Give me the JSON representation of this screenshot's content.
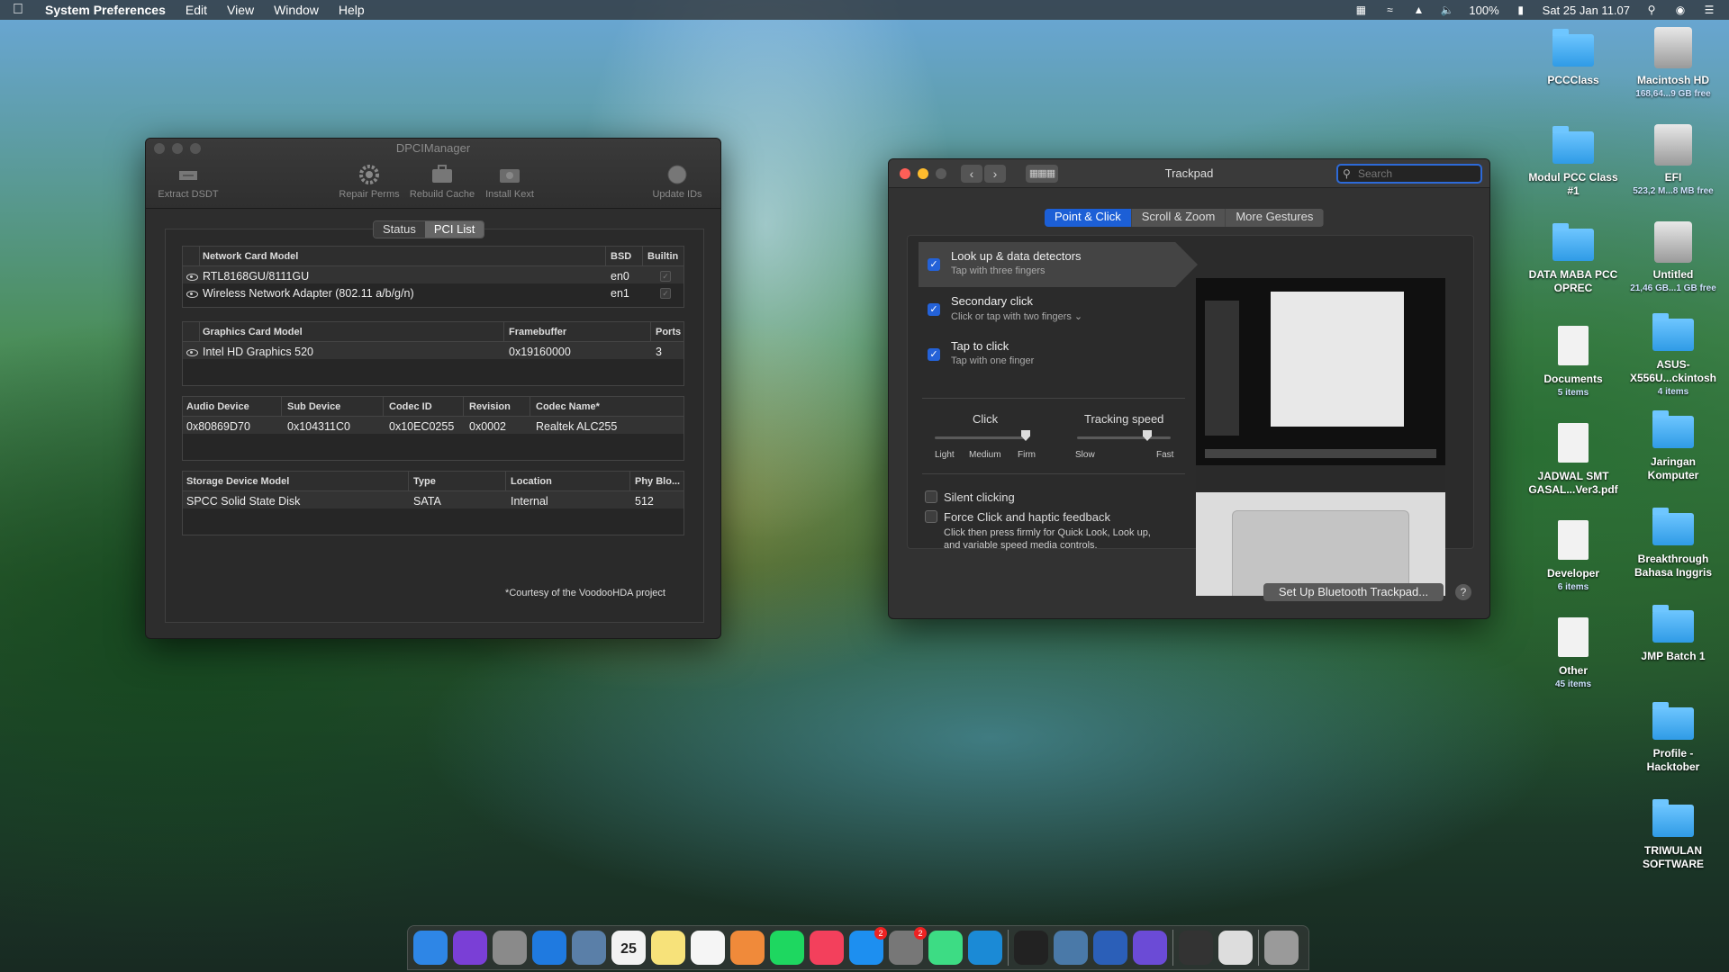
{
  "menubar": {
    "app_name": "System Preferences",
    "menus": [
      "Edit",
      "View",
      "Window",
      "Help"
    ],
    "battery": "100%",
    "datetime": "Sat 25 Jan  11.07"
  },
  "dpci": {
    "title": "DPCIManager",
    "toolbar": {
      "extract": "Extract DSDT",
      "repair": "Repair Perms",
      "rebuild": "Rebuild Cache",
      "install": "Install Kext",
      "update": "Update IDs"
    },
    "segments": {
      "status": "Status",
      "pci_list": "PCI List"
    },
    "network": {
      "headers": {
        "model": "Network Card Model",
        "bsd": "BSD",
        "builtin": "Builtin"
      },
      "rows": [
        {
          "model": "RTL8168GU/8111GU",
          "bsd": "en0"
        },
        {
          "model": "Wireless Network Adapter (802.11 a/b/g/n)",
          "bsd": "en1"
        }
      ]
    },
    "graphics": {
      "headers": {
        "model": "Graphics Card Model",
        "framebuffer": "Framebuffer",
        "ports": "Ports"
      },
      "rows": [
        {
          "model": "Intel HD Graphics 520",
          "framebuffer": "0x19160000",
          "ports": "3"
        }
      ]
    },
    "audio": {
      "headers": {
        "device": "Audio Device",
        "sub": "Sub Device",
        "codec": "Codec ID",
        "revision": "Revision",
        "name": "Codec Name*"
      },
      "rows": [
        {
          "device": "0x80869D70",
          "sub": "0x104311C0",
          "codec": "0x10EC0255",
          "revision": "0x0002",
          "name": "Realtek ALC255"
        }
      ]
    },
    "storage": {
      "headers": {
        "model": "Storage Device Model",
        "type": "Type",
        "location": "Location",
        "phy": "Phy Blo..."
      },
      "rows": [
        {
          "model": "SPCC Solid State Disk",
          "type": "SATA",
          "location": "Internal",
          "phy": "512"
        }
      ]
    },
    "courtesy": "*Courtesy of the VoodooHDA project"
  },
  "trackpad": {
    "title": "Trackpad",
    "search_placeholder": "Search",
    "tabs": {
      "point": "Point & Click",
      "scroll": "Scroll & Zoom",
      "more": "More Gestures"
    },
    "options": {
      "lookup": {
        "title": "Look up & data detectors",
        "sub": "Tap with three fingers"
      },
      "secondary": {
        "title": "Secondary click",
        "sub": "Click or tap with two fingers ⌄"
      },
      "tap": {
        "title": "Tap to click",
        "sub": "Tap with one finger"
      }
    },
    "click": {
      "label": "Click",
      "light": "Light",
      "medium": "Medium",
      "firm": "Firm",
      "value": "Firm"
    },
    "tracking": {
      "label": "Tracking speed",
      "slow": "Slow",
      "fast": "Fast",
      "value": 0.75
    },
    "silent": "Silent clicking",
    "force": {
      "title": "Force Click and haptic feedback",
      "desc1": "Click then press firmly for Quick Look, Look up,",
      "desc2": "and variable speed media controls."
    },
    "bt_button": "Set Up Bluetooth Trackpad...",
    "help": "?"
  },
  "desktop": {
    "left": [
      {
        "name": "PCCClass",
        "sub": "",
        "kind": "folder"
      },
      {
        "name": "Modul PCC Class #1",
        "sub": "",
        "kind": "folder"
      },
      {
        "name": "DATA MABA PCC OPREC",
        "sub": "",
        "kind": "folder"
      },
      {
        "name": "Documents",
        "sub": "5 items",
        "kind": "file"
      },
      {
        "name": "JADWAL SMT GASAL...Ver3.pdf",
        "sub": "",
        "kind": "file"
      },
      {
        "name": "Developer",
        "sub": "6 items",
        "kind": "file"
      },
      {
        "name": "Other",
        "sub": "45 items",
        "kind": "file"
      }
    ],
    "right": [
      {
        "name": "Macintosh HD",
        "sub": "168,64...9 GB free",
        "kind": "disk"
      },
      {
        "name": "EFI",
        "sub": "523,2 M...8 MB free",
        "kind": "disk"
      },
      {
        "name": "Untitled",
        "sub": "21,46 GB...1 GB free",
        "kind": "disk"
      },
      {
        "name": "ASUS-X556U...ckintosh",
        "sub": "4 items",
        "kind": "folder"
      },
      {
        "name": "Jaringan Komputer",
        "sub": "",
        "kind": "folder"
      },
      {
        "name": "Breakthrough Bahasa Inggris",
        "sub": "",
        "kind": "folder"
      },
      {
        "name": "JMP Batch 1",
        "sub": "",
        "kind": "folder"
      },
      {
        "name": "Profile - Hacktober",
        "sub": "",
        "kind": "folder"
      },
      {
        "name": "TRIWULAN SOFTWARE",
        "sub": "",
        "kind": "folder"
      }
    ]
  },
  "dock": {
    "apps": [
      {
        "name": "finder-icon",
        "color": "#2e86e6"
      },
      {
        "name": "siri-icon",
        "color": "#7a3fd6"
      },
      {
        "name": "launchpad-icon",
        "color": "#8a8a8a"
      },
      {
        "name": "safari-icon",
        "color": "#1f7ae0"
      },
      {
        "name": "preview-icon",
        "color": "#5a7fa8"
      },
      {
        "name": "calendar-icon",
        "color": "#f2f2f2",
        "label": "25"
      },
      {
        "name": "notes-icon",
        "color": "#f7e27a"
      },
      {
        "name": "reminders-icon",
        "color": "#f5f5f5"
      },
      {
        "name": "photos-icon",
        "color": "#f08a3a"
      },
      {
        "name": "spotify-icon",
        "color": "#1ed760"
      },
      {
        "name": "music-icon",
        "color": "#f3405c"
      },
      {
        "name": "app-store-icon",
        "color": "#1d8ff0",
        "badge": "2"
      },
      {
        "name": "system-preferences-icon",
        "color": "#777",
        "badge": "2"
      },
      {
        "name": "android-studio-icon",
        "color": "#3ddc84"
      },
      {
        "name": "vscode-icon",
        "color": "#1b8ad6"
      },
      {
        "name": "terminal-icon",
        "color": "#222"
      },
      {
        "name": "system-info-icon",
        "color": "#4a79a8"
      },
      {
        "name": "activity-monitor-icon",
        "color": "#2b5fb8"
      },
      {
        "name": "video-icon",
        "color": "#6b4bd6"
      },
      {
        "name": "screenshot-icon",
        "color": "#333"
      },
      {
        "name": "pci-icon",
        "color": "#ddd"
      },
      {
        "name": "trash-icon",
        "color": "#9a9a9a"
      }
    ]
  }
}
